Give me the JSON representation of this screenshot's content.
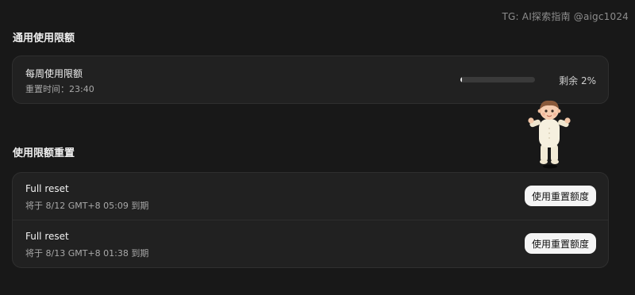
{
  "watermark": "TG: AI探索指南 @aigc1024",
  "general_limits": {
    "title": "通用使用限额",
    "weekly": {
      "title": "每周使用限额",
      "reset_time": "重置时间：23:40",
      "remaining_label": "剩余 2%",
      "remaining_fraction": 0.02
    }
  },
  "limit_resets": {
    "title": "使用限额重置",
    "items": [
      {
        "title": "Full reset",
        "expiry": "将于 8/12 GMT+8 05:09 到期",
        "button_label": "使用重置额度"
      },
      {
        "title": "Full reset",
        "expiry": "将于 8/13 GMT+8 01:38 到期",
        "button_label": "使用重置额度"
      }
    ]
  },
  "colors": {
    "background": "#181818",
    "card": "#212121",
    "button_bg": "#f5f5f5",
    "progress_fill": "#e8e8e8"
  }
}
